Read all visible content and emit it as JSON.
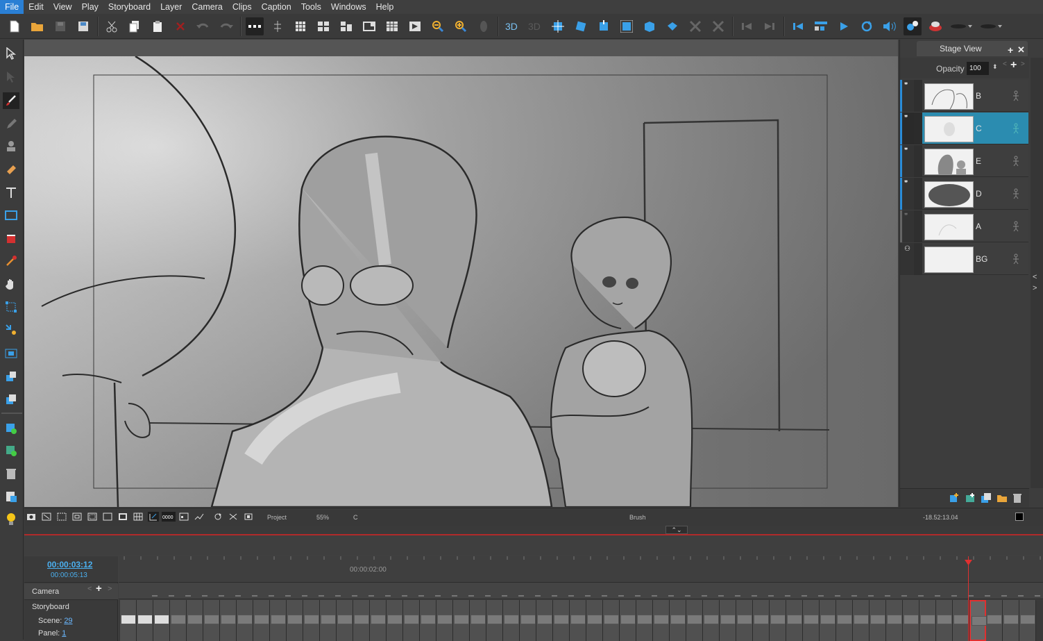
{
  "menu": [
    "File",
    "Edit",
    "View",
    "Play",
    "Storyboard",
    "Layer",
    "Camera",
    "Clips",
    "Caption",
    "Tools",
    "Windows",
    "Help"
  ],
  "colors": {
    "accent": "#2a7fd4",
    "selected_layer": "#2b8cb0",
    "timeline_border": "#b12a2a",
    "playhead": "#e03030"
  },
  "toolbar_icons": [
    "new-icon",
    "open-icon",
    "save-icon",
    "save-all-icon",
    "cut-icon",
    "copy-icon",
    "paste-icon",
    "delete-icon",
    "undo-icon",
    "redo-icon",
    "onion-icon",
    "stage-icon",
    "grid-icon",
    "thumbnails-icon",
    "panels-icon",
    "fit-icon",
    "timeline-icon",
    "reset-icon",
    "zoom-out-icon",
    "zoom-in-icon",
    "rotate-icon",
    "3d-icon",
    "3d-off-icon",
    "camera-move-icon",
    "camera-rotate-icon",
    "camera-zoom-icon",
    "camera-scale-icon",
    "camera-pan-icon",
    "camera-tilt-icon",
    "camera-x-icon",
    "camera-y-icon",
    "prev-icon",
    "next-icon",
    "first-icon",
    "playback-icon",
    "play-icon",
    "loop-icon",
    "sound-icon",
    "sync-icon",
    "record-icon",
    "brush-preset-icon",
    "brush-preset2-icon"
  ],
  "stage_view": {
    "title": "Stage View",
    "opacity_label": "Opacity",
    "opacity_value": "100",
    "layers": [
      {
        "name": "B",
        "selected": false
      },
      {
        "name": "C",
        "selected": true
      },
      {
        "name": "E",
        "selected": false
      },
      {
        "name": "D",
        "selected": false
      },
      {
        "name": "A",
        "selected": false
      },
      {
        "name": "BG",
        "selected": false
      }
    ]
  },
  "stagebar": {
    "mode": "Project",
    "zoom": "55%",
    "layer": "C",
    "tool": "Brush",
    "coords": "-18.52:13.04"
  },
  "timeline": {
    "current_time": "00:00:03:12",
    "duration": "00:00:05:13",
    "ruler_mark": "00:00:02:00",
    "camera_label": "Camera",
    "storyboard_label": "Storyboard",
    "scene_label": "Scene:",
    "scene_value": "29",
    "panel_label": "Panel:",
    "panel_value": "1"
  }
}
